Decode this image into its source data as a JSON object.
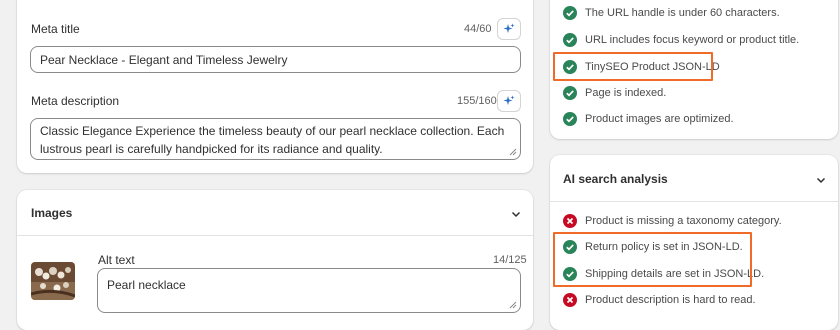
{
  "seo": {
    "meta_title": {
      "label": "Meta title",
      "counter": "44/60",
      "value": "Pear Necklace - Elegant and Timeless Jewelry"
    },
    "meta_description": {
      "label": "Meta description",
      "counter": "155/160",
      "value": "Classic Elegance Experience the timeless beauty of our pearl necklace collection. Each lustrous pearl is carefully handpicked for its radiance and quality."
    }
  },
  "images": {
    "title": "Images",
    "alt_text_label": "Alt text",
    "alt_counter": "14/125",
    "alt_value": "Pearl necklace"
  },
  "seo_checks": [
    {
      "text": "The URL handle is under 60 characters.",
      "status": "pass"
    },
    {
      "text": "URL includes focus keyword or product title.",
      "status": "pass"
    },
    {
      "text": "TinySEO Product JSON-LD",
      "status": "pass"
    },
    {
      "text": "Page is indexed.",
      "status": "pass"
    },
    {
      "text": "Product images are optimized.",
      "status": "pass"
    }
  ],
  "ai_search": {
    "title": "AI search analysis",
    "checks": [
      {
        "text": "Product is missing a taxonomy category.",
        "status": "fail"
      },
      {
        "text": "Return policy is set in JSON-LD.",
        "status": "pass"
      },
      {
        "text": "Shipping details are set in JSON-LD.",
        "status": "pass"
      },
      {
        "text": "Product description is hard to read.",
        "status": "fail"
      }
    ]
  },
  "colors": {
    "pass": "#29845a",
    "fail": "#c70a24",
    "highlight": "#f06a28",
    "ai_sparkle": "#2c6ecb"
  },
  "icons": [
    "sparkle-icon",
    "check-circle-icon",
    "x-circle-icon",
    "chevron-down-icon",
    "resize-grip-icon"
  ]
}
